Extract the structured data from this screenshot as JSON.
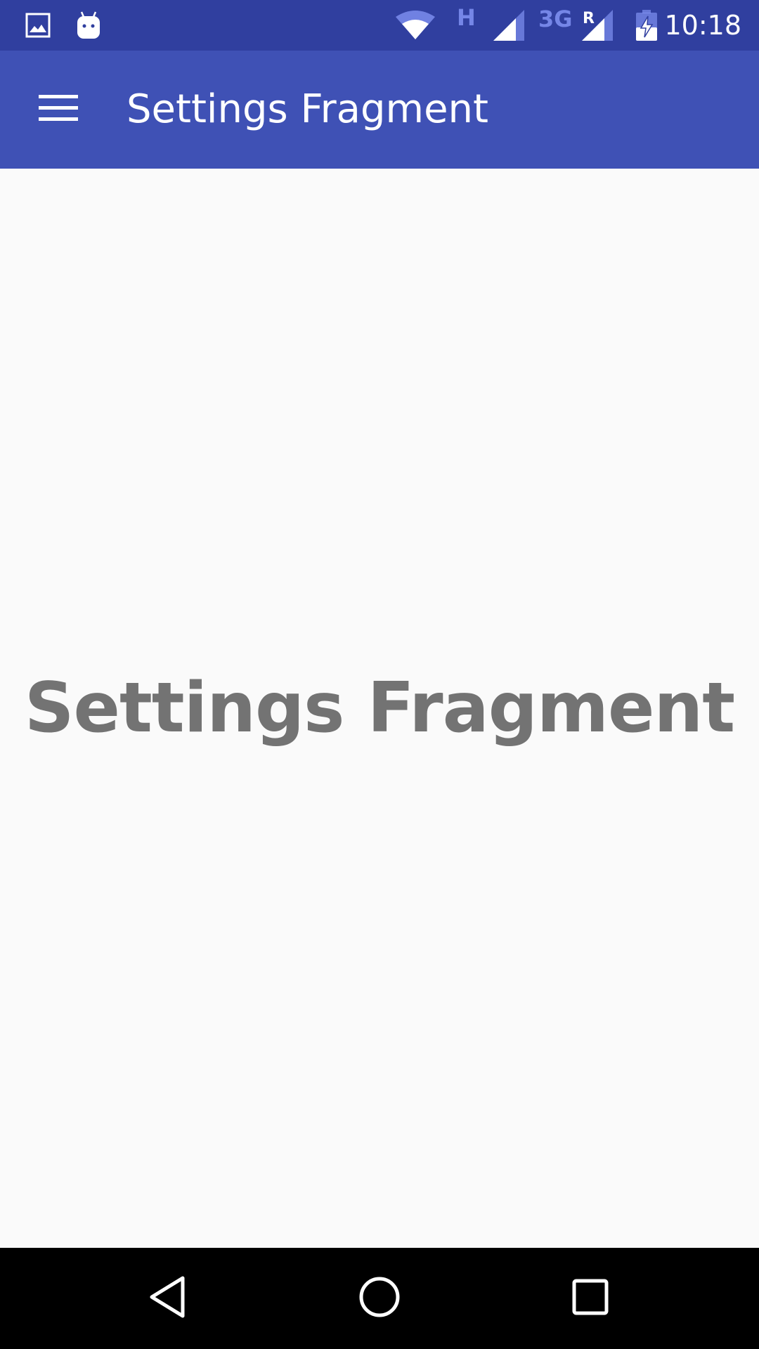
{
  "status_bar": {
    "time": "10:18",
    "network_type_h": "H",
    "network_type_3g": "3G",
    "roaming_indicator": "R",
    "icons": [
      "gallery-icon",
      "android-icon",
      "wifi-icon",
      "signal-icon",
      "signal-roaming-icon",
      "battery-charging-icon"
    ],
    "color": "#303f9f"
  },
  "app_bar": {
    "title": "Settings Fragment",
    "menu_icon": "hamburger-menu-icon",
    "color": "#3f51b5"
  },
  "content": {
    "text": "Settings Fragment",
    "text_color": "#737373",
    "background": "#fafafa"
  },
  "nav_bar": {
    "buttons": [
      "back-icon",
      "home-icon",
      "recents-icon"
    ]
  }
}
